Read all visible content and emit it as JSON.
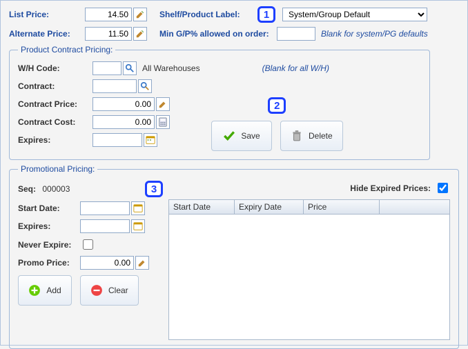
{
  "top": {
    "list_price_label": "List Price:",
    "list_price_value": "14.50",
    "alternate_price_label": "Alternate Price:",
    "alternate_price_value": "11.50",
    "shelf_label_label": "Shelf/Product Label:",
    "shelf_label_value": "System/Group Default",
    "min_gp_label": "Min G/P% allowed on order:",
    "min_gp_value": "",
    "min_gp_hint": "Blank for system/PG defaults"
  },
  "callouts": {
    "one": "1",
    "two": "2",
    "three": "3"
  },
  "contract": {
    "legend": "Product Contract Pricing:",
    "wh_code_label": "W/H Code:",
    "wh_code_value": "",
    "wh_code_caption": "All Warehouses",
    "wh_hint": "(Blank for all W/H)",
    "contract_label": "Contract:",
    "contract_value": "",
    "contract_price_label": "Contract Price:",
    "contract_price_value": "0.00",
    "contract_cost_label": "Contract Cost:",
    "contract_cost_value": "0.00",
    "expires_label": "Expires:",
    "expires_value": "",
    "save_label": "Save",
    "delete_label": "Delete"
  },
  "promo": {
    "legend": "Promotional Pricing:",
    "seq_label": "Seq:",
    "seq_value": "000003",
    "start_date_label": "Start Date:",
    "start_date_value": "",
    "expires_label": "Expires:",
    "expires_value": "",
    "never_expire_label": "Never Expire:",
    "never_expire_checked": false,
    "promo_price_label": "Promo Price:",
    "promo_price_value": "0.00",
    "add_label": "Add",
    "clear_label": "Clear",
    "hide_expired_label": "Hide Expired Prices:",
    "hide_expired_checked": true,
    "grid_headers": {
      "start": "Start Date",
      "expiry": "Expiry Date",
      "price": "Price"
    }
  }
}
